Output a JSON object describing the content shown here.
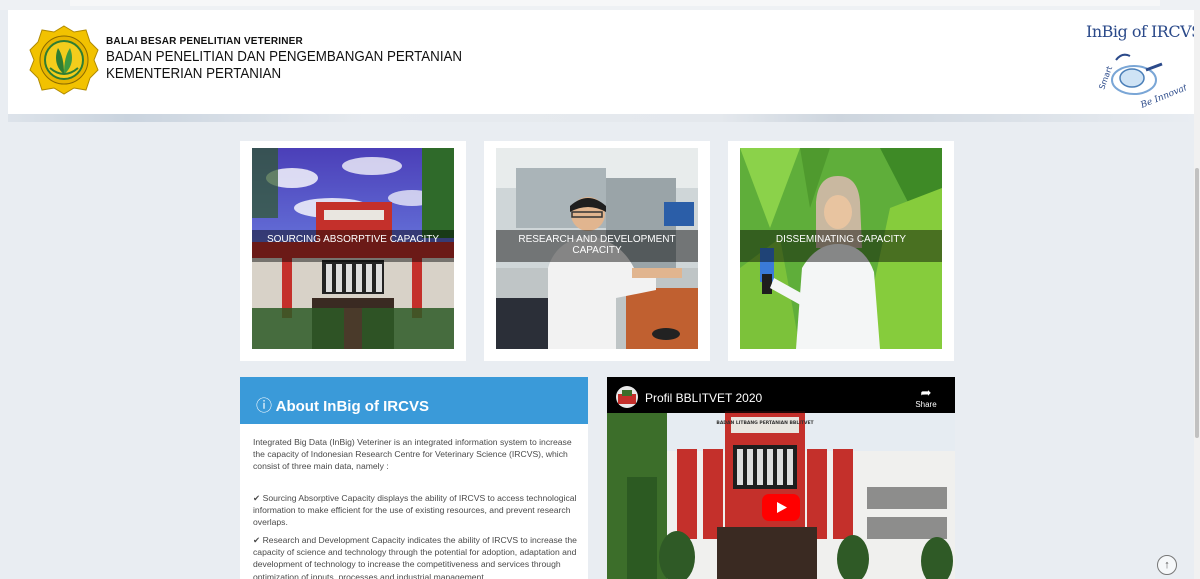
{
  "header": {
    "line1": "BALAI BESAR PENELITIAN VETERINER",
    "line2": "BADAN PENELITIAN DAN PENGEMBANGAN PERTANIAN",
    "line3": "KEMENTERIAN PERTANIAN",
    "brand_title": "InBig of IRCVS",
    "brand_tag_left": "Smart",
    "brand_tag_right": "Be Innovative"
  },
  "cards": [
    {
      "caption": "SOURCING ABSORPTIVE CAPACITY"
    },
    {
      "caption": "RESEARCH AND DEVELOPMENT CAPACITY"
    },
    {
      "caption": "DISSEMINATING CAPACITY"
    }
  ],
  "about": {
    "title": "About InBig of IRCVS",
    "intro": "Integrated Big Data (InBig) Veteriner is an integrated information system to increase the capacity of Indonesian Research Centre for Veterinary Science (IRCVS), which consist of three main data, namely :",
    "bullet1": "Sourcing Absorptive Capacity displays the ability of IRCVS to access technological information to make efficient for the use of existing resources, and prevent research overlaps.",
    "bullet2": "Research and Development Capacity indicates the ability of IRCVS to increase the capacity of science and technology through the potential for adoption, adaptation and development of technology to increase the competitiveness and services through optimization of inputs, processes and industrial management."
  },
  "video": {
    "title": "Profil BBLITVET 2020",
    "share_label": "Share",
    "building_sign": "BADAN LITBANG PERTANIAN BBLITVET"
  },
  "icons": {
    "info": "ⓘ",
    "check": "✔",
    "share": "➦",
    "scroll_up": "↑"
  }
}
